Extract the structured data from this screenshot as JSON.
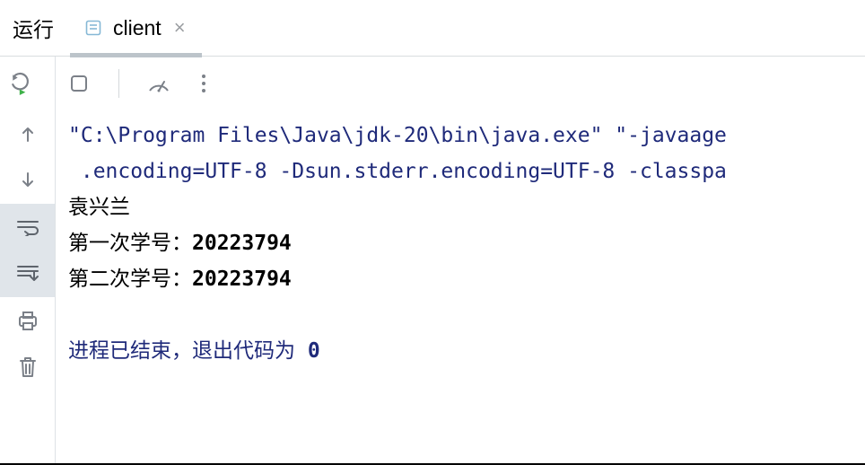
{
  "tabbar": {
    "run_label": "运行",
    "tab": {
      "label": "client",
      "close_glyph": "×"
    }
  },
  "console": {
    "cmd_line1": "\"C:\\Program Files\\Java\\jdk-20\\bin\\java.exe\" \"-javaage",
    "cmd_line2": " .encoding=UTF-8 -Dsun.stderr.encoding=UTF-8 -classpa",
    "out_line1": "袁兴兰",
    "out_line2_label": "第一次学号：",
    "out_line2_value": "20223794",
    "out_line3_label": "第二次学号：",
    "out_line3_value": "20223794",
    "exit_label": "进程已结束，退出代码为 ",
    "exit_code": "0"
  }
}
